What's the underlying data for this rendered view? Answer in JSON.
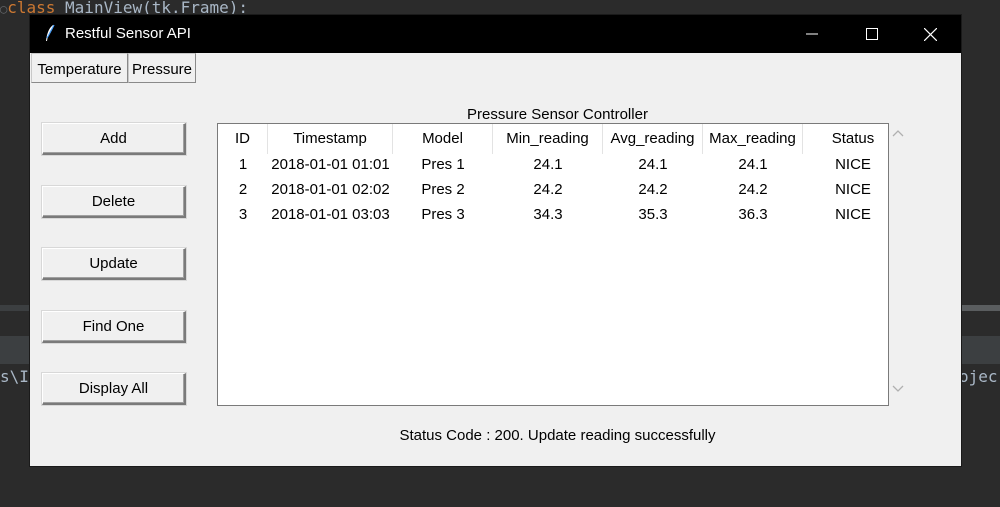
{
  "ide": {
    "top_keyword": "class",
    "top_code": " MainView(tk.Frame):",
    "left_fragment": "s\\I",
    "right_fragment": "ojec"
  },
  "window": {
    "title": "Restful Sensor API",
    "minimize_label": "—",
    "close_label": "✕"
  },
  "tabs": [
    {
      "label": "Temperature"
    },
    {
      "label": "Pressure"
    }
  ],
  "heading": "Pressure Sensor Controller",
  "actions": [
    {
      "label": "Add"
    },
    {
      "label": "Delete"
    },
    {
      "label": "Update"
    },
    {
      "label": "Find One"
    },
    {
      "label": "Display All"
    }
  ],
  "table": {
    "columns": [
      "ID",
      "Timestamp",
      "Model",
      "Min_reading",
      "Avg_reading",
      "Max_reading",
      "Status"
    ],
    "rows": [
      [
        "1",
        "2018-01-01 01:01",
        "Pres 1",
        "24.1",
        "24.1",
        "24.1",
        "NICE"
      ],
      [
        "2",
        "2018-01-01 02:02",
        "Pres 2",
        "24.2",
        "24.2",
        "24.2",
        "NICE"
      ],
      [
        "3",
        "2018-01-01 03:03",
        "Pres 3",
        "34.3",
        "35.3",
        "36.3",
        "NICE"
      ]
    ]
  },
  "status": {
    "label": "Status Code :",
    "code": "200.",
    "message": "Update reading successfully"
  }
}
